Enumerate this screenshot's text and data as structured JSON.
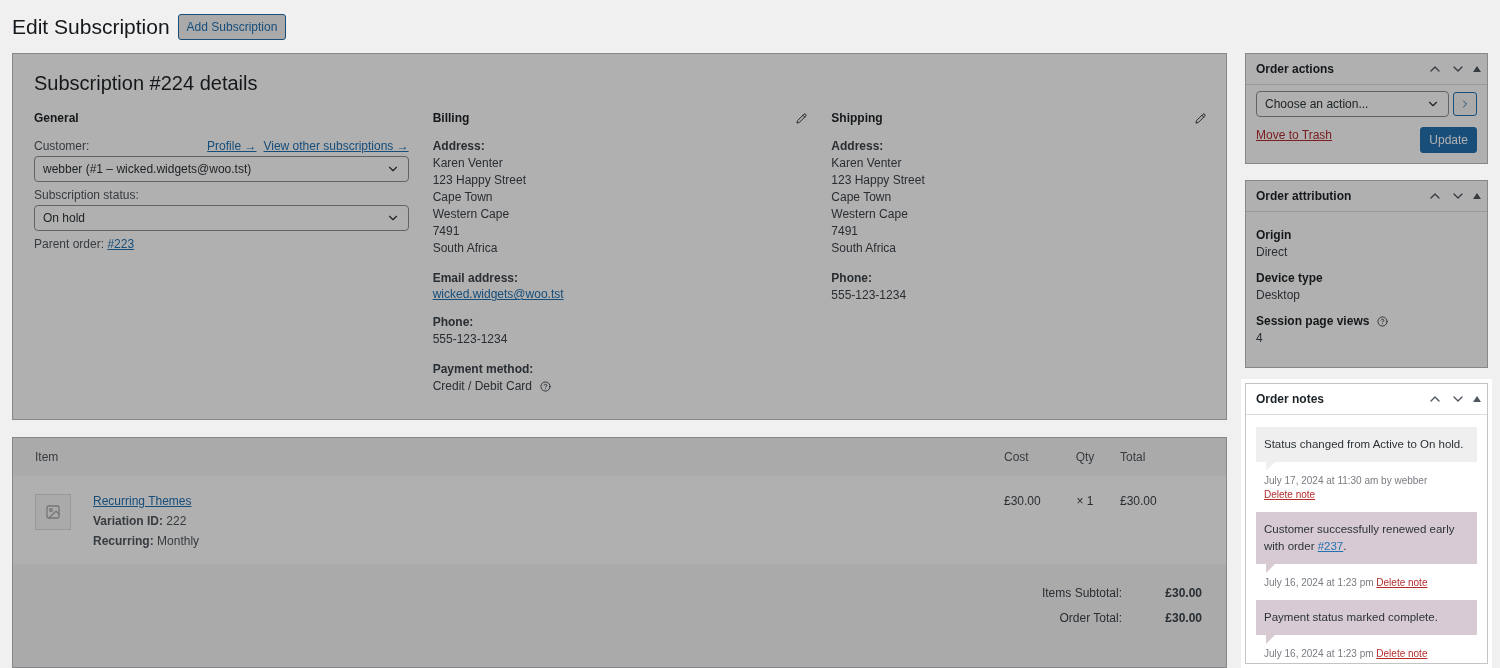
{
  "page": {
    "title": "Edit Subscription",
    "add_button": "Add Subscription"
  },
  "details": {
    "title": "Subscription #224 details",
    "general": {
      "heading": "General",
      "customer_label": "Customer:",
      "links": [
        "Profile →",
        "View other subscriptions →"
      ],
      "customer_value": "webber (#1 – wicked.widgets@woo.tst)",
      "status_label": "Subscription status:",
      "status_value": "On hold",
      "parent_label": "Parent order:",
      "parent_link": "#223"
    },
    "addresses": [
      {
        "heading": "Billing",
        "fields": [
          {
            "kind": "lines",
            "label": "Address:",
            "lines": [
              "Karen Venter",
              "123 Happy Street",
              "Cape Town",
              "Western Cape",
              "7491",
              "South Africa"
            ]
          },
          {
            "kind": "link",
            "label": "Email address:",
            "lines": [
              "wicked.widgets@woo.tst"
            ]
          },
          {
            "kind": "lines",
            "label": "Phone:",
            "lines": [
              "555-123-1234"
            ]
          },
          {
            "kind": "help",
            "label": "Payment method:",
            "lines": [
              "Credit / Debit Card"
            ]
          }
        ]
      },
      {
        "heading": "Shipping",
        "fields": [
          {
            "kind": "lines",
            "label": "Address:",
            "lines": [
              "Karen Venter",
              "123 Happy Street",
              "Cape Town",
              "Western Cape",
              "7491",
              "South Africa"
            ]
          },
          {
            "kind": "lines",
            "label": "Phone:",
            "lines": [
              "555-123-1234"
            ]
          }
        ]
      }
    ]
  },
  "items": {
    "columns": [
      "Item",
      "Cost",
      "Qty",
      "Total"
    ],
    "rows": [
      {
        "name": "Recurring Themes",
        "meta": [
          {
            "label": "Variation ID:",
            "value": "222"
          },
          {
            "label": "Recurring:",
            "value": "Monthly"
          }
        ],
        "cost": "£30.00",
        "qty": "× 1",
        "total": "£30.00"
      }
    ],
    "totals": [
      {
        "label": "Items Subtotal:",
        "value": "£30.00"
      },
      {
        "label": "Order Total:",
        "value": "£30.00"
      }
    ]
  },
  "order_actions": {
    "title": "Order actions",
    "select": "Choose an action...",
    "trash": "Move to Trash",
    "update": "Update"
  },
  "attribution": {
    "title": "Order attribution",
    "fields": [
      {
        "kind": "plain",
        "label": "Origin",
        "value": "Direct"
      },
      {
        "kind": "plain",
        "label": "Device type",
        "value": "Desktop"
      },
      {
        "kind": "help",
        "label": "Session page views",
        "value": "4"
      }
    ]
  },
  "order_notes": {
    "title": "Order notes",
    "notes": [
      {
        "kind": "system",
        "text": "Status changed from Active to On hold.",
        "meta": "July 17, 2024 at 11:30 am by webber",
        "delete": "Delete note"
      },
      {
        "kind": "private",
        "text": "Customer successfully renewed early with order ",
        "link": "#237",
        "after": ".",
        "meta": "July 16, 2024 at 1:23 pm",
        "delete": "Delete note"
      },
      {
        "kind": "private",
        "text": "Payment status marked complete.",
        "meta": "July 16, 2024 at 1:23 pm",
        "delete": "Delete note"
      }
    ]
  }
}
